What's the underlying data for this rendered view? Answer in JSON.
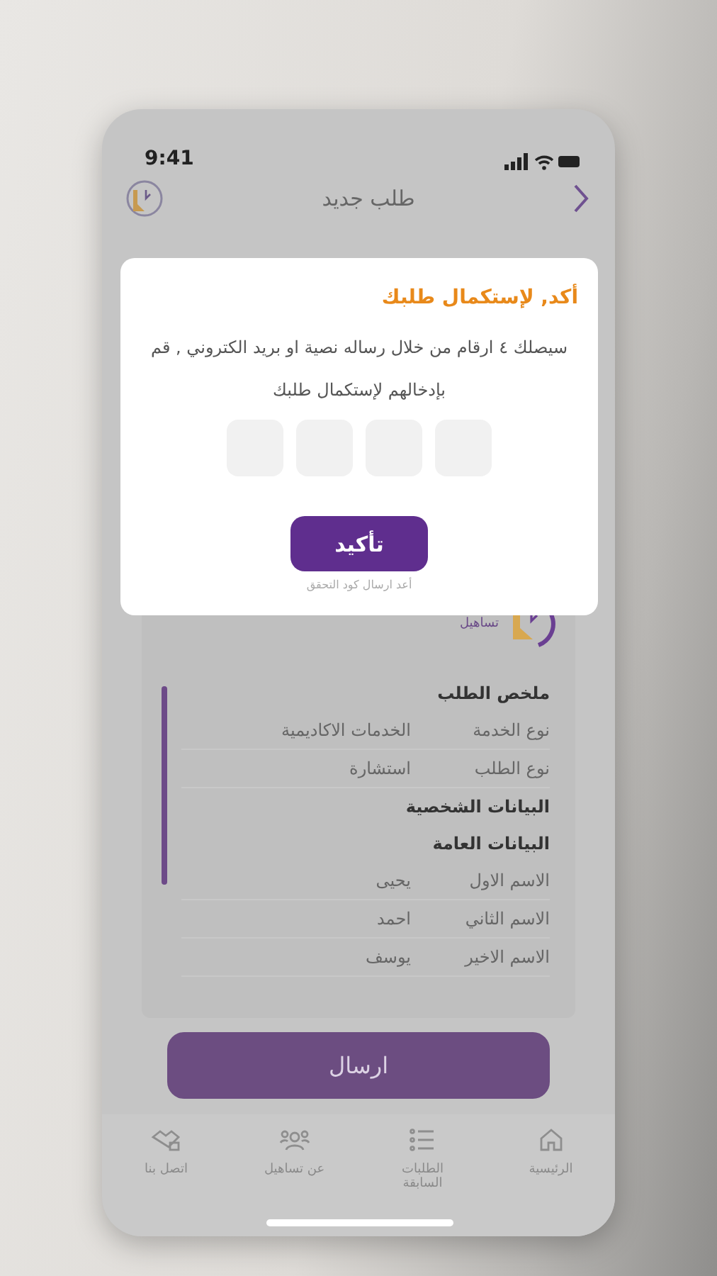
{
  "status_bar": {
    "time": "9:41"
  },
  "header": {
    "title": "طلب جديد"
  },
  "dialog": {
    "title": "أكد, لإستكمال طلبك",
    "message": "سيصلك ٤ ارقام من خلال رساله نصية او بريد الكتروني , قم بإدخالهم لإستكمال طلبك",
    "code_boxes": [
      {
        "filled": false
      },
      {
        "filled": false
      },
      {
        "filled": false
      },
      {
        "filled": false
      }
    ],
    "confirm": "تأكيد",
    "resend": "أعد ارسال كود التحقق"
  },
  "brand": {
    "name": "تساهيل"
  },
  "summary": [
    {
      "kind": "heading",
      "text": "ملخص الطلب"
    },
    {
      "kind": "row",
      "label": "نوع الخدمة",
      "value": "الخدمات الاكاديمية"
    },
    {
      "kind": "row",
      "label": "نوع الطلب",
      "value": "استشارة"
    },
    {
      "kind": "heading",
      "text": "البيانات الشخصية"
    },
    {
      "kind": "heading",
      "text": "البيانات العامة"
    },
    {
      "kind": "row",
      "label": "الاسم الاول",
      "value": "يحيى"
    },
    {
      "kind": "row",
      "label": "الاسم الثاني",
      "value": "احمد"
    },
    {
      "kind": "row",
      "label": "الاسم الاخير",
      "value": "يوسف"
    }
  ],
  "submit": "ارسال",
  "nav": [
    {
      "label": "الرئيسية"
    },
    {
      "label": "الطلبات السابقة"
    },
    {
      "label": "عن تساهيل"
    },
    {
      "label": "اتصل بنا"
    }
  ]
}
